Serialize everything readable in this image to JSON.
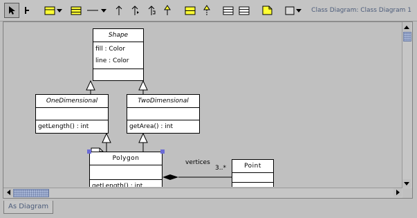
{
  "window_title": "Class Diagram: Class Diagram 1",
  "toolbar": {
    "tools": [
      "select",
      "broom",
      "class",
      "dropdown",
      "attribute-compartment",
      "line",
      "dropdown",
      "association-arrow",
      "composition-arrow",
      "dependency-arrow",
      "generalization-arrow",
      "interface",
      "realization",
      "interface-compartment",
      "operation-compartment",
      "note",
      "shape-fill",
      "dropdown"
    ]
  },
  "diagram": {
    "classes": {
      "shape": {
        "name": "Shape",
        "attributes": [
          "fill : Color",
          "line : Color"
        ]
      },
      "one_dimensional": {
        "name": "OneDimensional",
        "operations": [
          "getLength() : int"
        ]
      },
      "two_dimensional": {
        "name": "TwoDimensional",
        "operations": [
          "getArea() : int"
        ]
      },
      "polygon": {
        "name": "Polygon",
        "operations": [
          "getLength() : int"
        ]
      },
      "point": {
        "name": "Point"
      }
    },
    "association": {
      "role": "vertices",
      "multiplicity": "3..*"
    }
  },
  "tabs": {
    "as_diagram": "As Diagram"
  },
  "colors": {
    "canvas": "#c0c0c0",
    "title_text": "#4c5c7a",
    "selection_handle": "#6b6bd6",
    "scroll_thumb": "#a9b8d8"
  }
}
